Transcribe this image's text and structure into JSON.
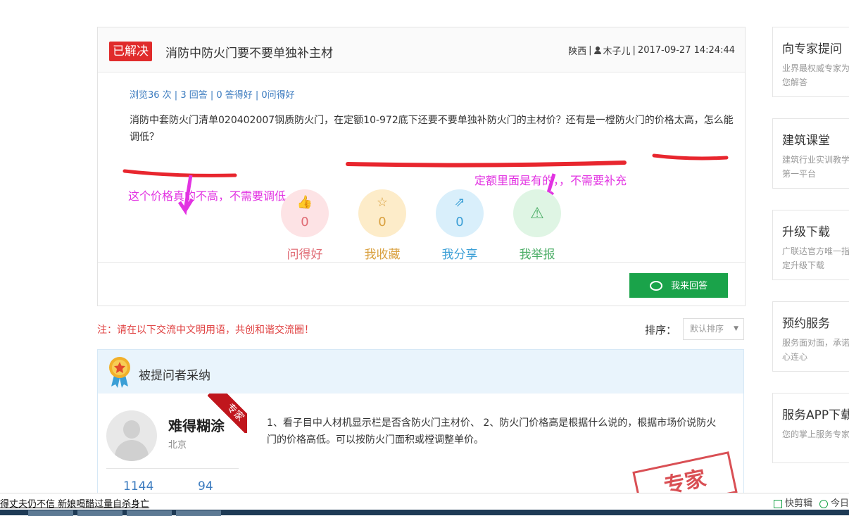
{
  "question": {
    "badge": "已解决",
    "title": "消防中防火门要不要单独补主材",
    "region": "陕西",
    "author": "木子儿",
    "date": "2017-09-27 14:24:44",
    "sep": "|",
    "stats": "浏览36 次 | 3 回答 | 0 答得好 | 0问得好",
    "body": "消防中套防火门清单020402007钢质防火门，在定额10-972底下还要不要单独补防火门的主材价？还有是一樘防火门的价格太高，怎么能调低？"
  },
  "annotations": {
    "left": "这个价格真的不高，不需要调低",
    "right": "定额里面是有的，，不需要补充",
    "color": "#e233e2"
  },
  "actions": [
    {
      "icon": "thumbs-up-icon",
      "glyph": "👍",
      "count": "0",
      "label": "问得好",
      "bg": "#fde3e5",
      "fg": "#e06b74"
    },
    {
      "icon": "star-icon",
      "glyph": "☆",
      "count": "0",
      "label": "我收藏",
      "bg": "#fdecc9",
      "fg": "#d9a03f"
    },
    {
      "icon": "share-icon",
      "glyph": "⇗",
      "count": "0",
      "label": "我分享",
      "bg": "#d9effb",
      "fg": "#3b9fd6"
    },
    {
      "icon": "warning-icon",
      "glyph": "⚠",
      "count": "",
      "label": "我举报",
      "bg": "#dff5e4",
      "fg": "#4cae67"
    }
  ],
  "answer_button": "我来回答",
  "notice": "注：请在以下交流中文明用语，共创和谐交流圈！",
  "sort": {
    "label": "排序：",
    "selected": "默认排序",
    "arrow": "▼"
  },
  "adopted": {
    "title": "被提问者采纳",
    "user": {
      "name": "难得糊涂",
      "location": "北京",
      "stat1": "1144",
      "stat2": "94",
      "ribbon": "专家"
    },
    "text": "1、看子目中人材机显示栏是否含防火门主材价、 2、防火门价格高是根据什么说的，根据市场价说防火门的价格高低。可以按防火门面积或樘调整单价。",
    "stamp": "专家"
  },
  "sidebar": [
    {
      "title": "向专家提问",
      "desc": "业界最权威专家为您解答"
    },
    {
      "title": "建筑课堂",
      "desc": "建筑行业实训教学第一平台"
    },
    {
      "title": "升级下载",
      "desc": "广联达官方唯一指定升级下载"
    },
    {
      "title": "预约服务",
      "desc": "服务面对面，承诺心连心"
    },
    {
      "title": "服务APP下载",
      "desc": "您的掌上服务专家"
    }
  ],
  "statusbar": {
    "news": "得丈夫仍不信 新娘喝醋过量自杀身亡",
    "items": [
      "快剪辑",
      "今日"
    ]
  }
}
